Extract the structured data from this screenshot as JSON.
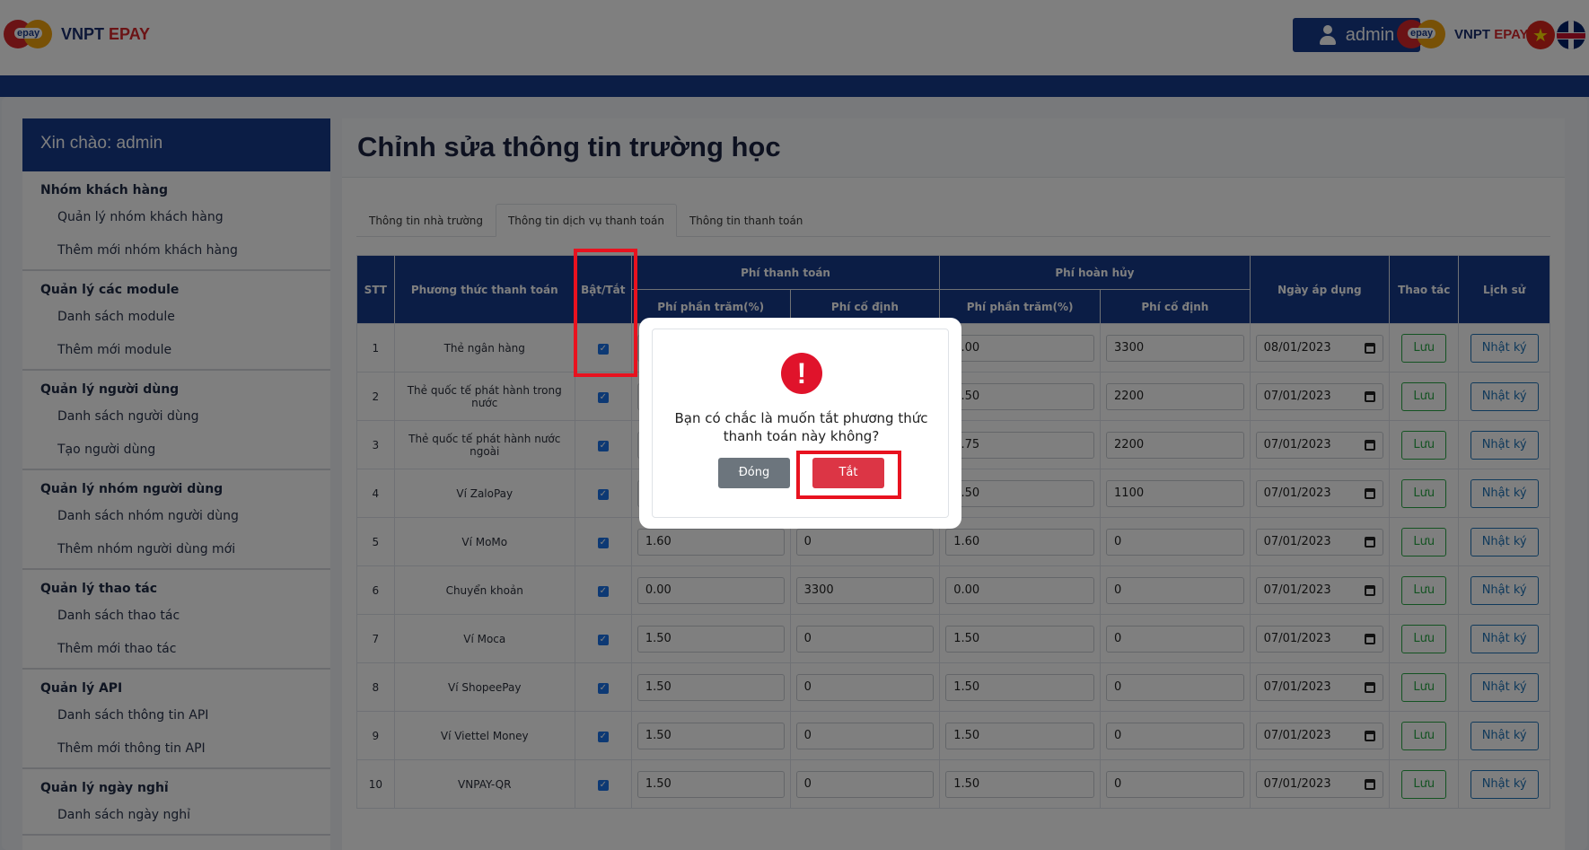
{
  "header": {
    "logo_badge": "epay",
    "logo_name_a": "VNPT",
    "logo_name_b": "EPAY",
    "user_label": "admin",
    "lang_vi_icon": "vietnam-flag-icon",
    "lang_en_icon": "uk-flag-icon"
  },
  "sidebar": {
    "greeting": "Xin chào: admin",
    "groups": [
      {
        "title": "Nhóm khách hàng",
        "items": [
          "Quản lý nhóm khách hàng",
          "Thêm mới nhóm khách hàng"
        ]
      },
      {
        "title": "Quản lý các module",
        "items": [
          "Danh sách module",
          "Thêm mới module"
        ]
      },
      {
        "title": "Quản lý người dùng",
        "items": [
          "Danh sách người dùng",
          "Tạo người dùng"
        ]
      },
      {
        "title": "Quản lý nhóm người dùng",
        "items": [
          "Danh sách nhóm người dùng",
          "Thêm nhóm người dùng mới"
        ]
      },
      {
        "title": "Quản lý thao tác",
        "items": [
          "Danh sách thao tác",
          "Thêm mới thao tác"
        ]
      },
      {
        "title": "Quản lý API",
        "items": [
          "Danh sách thông tin API",
          "Thêm mới thông tin API"
        ]
      },
      {
        "title": "Quản lý ngày nghỉ",
        "items": [
          "Danh sách ngày nghỉ"
        ]
      }
    ]
  },
  "page": {
    "title": "Chỉnh sửa thông tin trường học",
    "tabs": [
      "Thông tin nhà trường",
      "Thông tin dịch vụ thanh toán",
      "Thông tin thanh toán"
    ],
    "active_tab": 1
  },
  "table": {
    "headers": {
      "stt": "STT",
      "method": "Phương thức thanh toán",
      "toggle": "Bật/Tắt",
      "pay_fee": "Phí thanh toán",
      "refund_fee": "Phí hoàn hủy",
      "pct": "Phí phần trăm(%)",
      "fixed": "Phí cố định",
      "date": "Ngày áp dụng",
      "action": "Thao tác",
      "history": "Lịch sử"
    },
    "save_label": "Lưu",
    "log_label": "Nhật ký",
    "rows": [
      {
        "stt": "1",
        "method": "Thẻ ngân hàng",
        "enabled": true,
        "pay_pct": "",
        "pay_fixed": "",
        "ref_pct": "0.00",
        "ref_fixed": "3300",
        "date": "08/01/2023"
      },
      {
        "stt": "2",
        "method": "Thẻ quốc tế phát hành trong nước",
        "enabled": true,
        "pay_pct": "",
        "pay_fixed": "",
        "ref_pct": "1.50",
        "ref_fixed": "2200",
        "date": "07/01/2023"
      },
      {
        "stt": "3",
        "method": "Thẻ quốc tế phát hành nước ngoài",
        "enabled": true,
        "pay_pct": "",
        "pay_fixed": "",
        "ref_pct": "2.75",
        "ref_fixed": "2200",
        "date": "07/01/2023"
      },
      {
        "stt": "4",
        "method": "Ví ZaloPay",
        "enabled": true,
        "pay_pct": "",
        "pay_fixed": "",
        "ref_pct": "1.50",
        "ref_fixed": "1100",
        "date": "07/01/2023"
      },
      {
        "stt": "5",
        "method": "Ví MoMo",
        "enabled": true,
        "pay_pct": "1.60",
        "pay_fixed": "0",
        "ref_pct": "1.60",
        "ref_fixed": "0",
        "date": "07/01/2023"
      },
      {
        "stt": "6",
        "method": "Chuyển khoản",
        "enabled": true,
        "pay_pct": "0.00",
        "pay_fixed": "3300",
        "ref_pct": "0.00",
        "ref_fixed": "0",
        "date": "07/01/2023"
      },
      {
        "stt": "7",
        "method": "Ví Moca",
        "enabled": true,
        "pay_pct": "1.50",
        "pay_fixed": "0",
        "ref_pct": "1.50",
        "ref_fixed": "0",
        "date": "07/01/2023"
      },
      {
        "stt": "8",
        "method": "Ví ShopeePay",
        "enabled": true,
        "pay_pct": "1.50",
        "pay_fixed": "0",
        "ref_pct": "1.50",
        "ref_fixed": "0",
        "date": "07/01/2023"
      },
      {
        "stt": "9",
        "method": "Ví Viettel Money",
        "enabled": true,
        "pay_pct": "1.50",
        "pay_fixed": "0",
        "ref_pct": "1.50",
        "ref_fixed": "0",
        "date": "07/01/2023"
      },
      {
        "stt": "10",
        "method": "VNPAY-QR",
        "enabled": true,
        "pay_pct": "1.50",
        "pay_fixed": "0",
        "ref_pct": "1.50",
        "ref_fixed": "0",
        "date": "07/01/2023"
      }
    ]
  },
  "dialog": {
    "icon": "exclamation-icon",
    "message": "Bạn có chắc là muốn tắt phương thức thanh toán này không?",
    "close_label": "Đóng",
    "confirm_label": "Tắt"
  },
  "colors": {
    "primary": "#163a8a",
    "danger": "#dc3545",
    "highlight": "#e8121f",
    "success": "#28a745"
  }
}
